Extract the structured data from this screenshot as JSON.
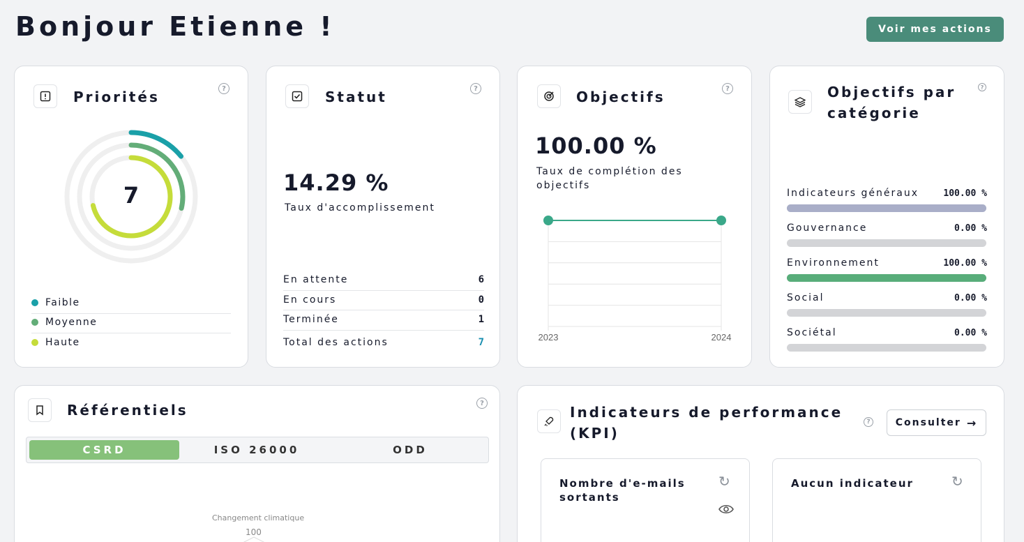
{
  "header": {
    "greeting": "Bonjour Etienne !",
    "actions_button": "Voir mes actions"
  },
  "priorities": {
    "title": "Priorités",
    "total": "7",
    "legend": [
      {
        "label": "Faible",
        "color": "#1aa0a8"
      },
      {
        "label": "Moyenne",
        "color": "#63ad78"
      },
      {
        "label": "Haute",
        "color": "#c5dc3a"
      }
    ]
  },
  "status": {
    "title": "Statut",
    "percent": "14.29 %",
    "caption": "Taux d'accomplissement",
    "rows": [
      {
        "label": "En attente",
        "value": "6"
      },
      {
        "label": "En cours",
        "value": "0"
      },
      {
        "label": "Terminée",
        "value": "1"
      }
    ],
    "total_label": "Total des actions",
    "total_value": "7"
  },
  "objectives": {
    "title": "Objectifs",
    "percent": "100.00 %",
    "caption": "Taux de complétion des objectifs",
    "chart_data": {
      "type": "line",
      "x": [
        "2023",
        "2024"
      ],
      "series": [
        {
          "values": [
            100,
            100
          ]
        }
      ],
      "ylim": [
        0,
        100
      ]
    }
  },
  "category": {
    "title_line1": "Objectifs par",
    "title_line2": "catégorie",
    "items": [
      {
        "label": "Indicateurs généraux",
        "value": "100.00 %",
        "fraction": 1,
        "color": "#a9aec8"
      },
      {
        "label": "Gouvernance",
        "value": "0.00 %",
        "fraction": 0,
        "color": "#d3d4d7"
      },
      {
        "label": "Environnement",
        "value": "100.00 %",
        "fraction": 1,
        "color": "#58ad7a"
      },
      {
        "label": "Social",
        "value": "0.00 %",
        "fraction": 0,
        "color": "#d3d4d7"
      },
      {
        "label": "Sociétal",
        "value": "0.00 %",
        "fraction": 0,
        "color": "#d3d4d7"
      }
    ]
  },
  "referentiels": {
    "title": "Référentiels",
    "tabs": [
      {
        "label": "CSRD",
        "active": true
      },
      {
        "label": "ISO 26000",
        "active": false
      },
      {
        "label": "ODD",
        "active": false
      }
    ],
    "radar_axis": "Changement climatique",
    "radar_tick": "100"
  },
  "kpi": {
    "title_line1": "Indicateurs de performance",
    "title_line2": "(KPI)",
    "consult_button": "Consulter",
    "cards": [
      {
        "title_line1": "Nombre d'e-mails",
        "title_line2": "sortants"
      },
      {
        "title_line1": "Aucun indicateur"
      }
    ]
  }
}
